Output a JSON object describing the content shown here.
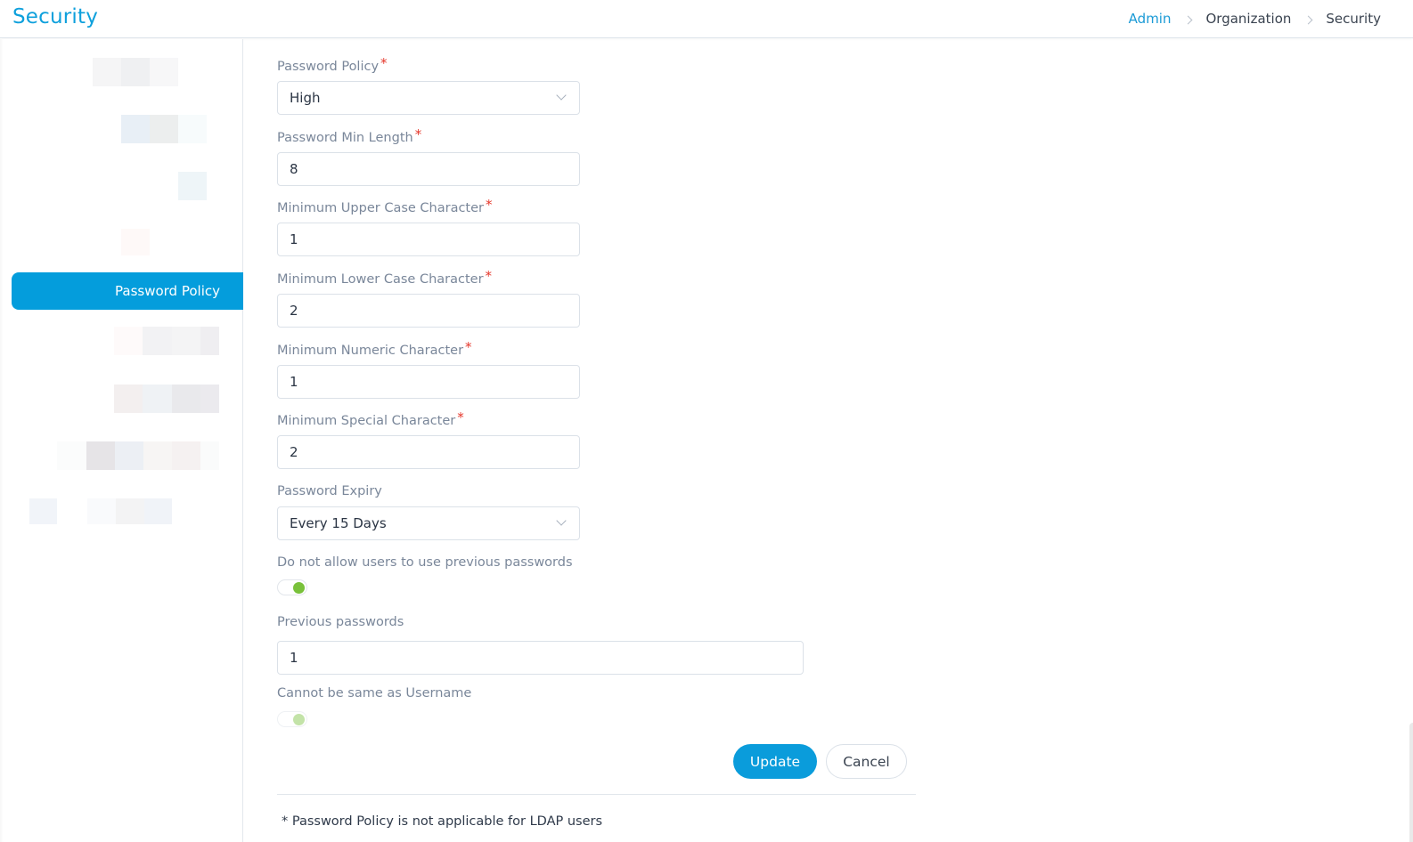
{
  "header": {
    "title": "Security",
    "breadcrumb": [
      {
        "label": "Admin",
        "link": true
      },
      {
        "label": "Organization",
        "link": false
      },
      {
        "label": "Security",
        "link": false
      }
    ]
  },
  "sidebar": {
    "active_item": "Password Policy"
  },
  "form": {
    "password_policy": {
      "label": "Password Policy",
      "required": "*",
      "value": "High"
    },
    "min_length": {
      "label": "Password Min Length",
      "required": "*",
      "value": "8"
    },
    "min_upper": {
      "label": "Minimum Upper Case Character",
      "required": "*",
      "value": "1"
    },
    "min_lower": {
      "label": "Minimum Lower Case Character",
      "required": "*",
      "value": "2"
    },
    "min_numeric": {
      "label": "Minimum Numeric Character",
      "required": "*",
      "value": "1"
    },
    "min_special": {
      "label": "Minimum Special Character",
      "required": "*",
      "value": "2"
    },
    "expiry": {
      "label": "Password Expiry",
      "value": "Every 15 Days"
    },
    "no_previous": {
      "label": "Do not allow users to use previous passwords",
      "enabled": true
    },
    "previous_count": {
      "label": "Previous passwords",
      "value": "1"
    },
    "not_username": {
      "label": "Cannot be same as Username",
      "enabled": true,
      "disabled_state": true
    }
  },
  "actions": {
    "update_label": "Update",
    "cancel_label": "Cancel"
  },
  "footnote": "* Password Policy is not applicable for LDAP users",
  "colors": {
    "accent": "#049ddc",
    "required": "#e5372b",
    "toggle_on": "#79c13a"
  }
}
